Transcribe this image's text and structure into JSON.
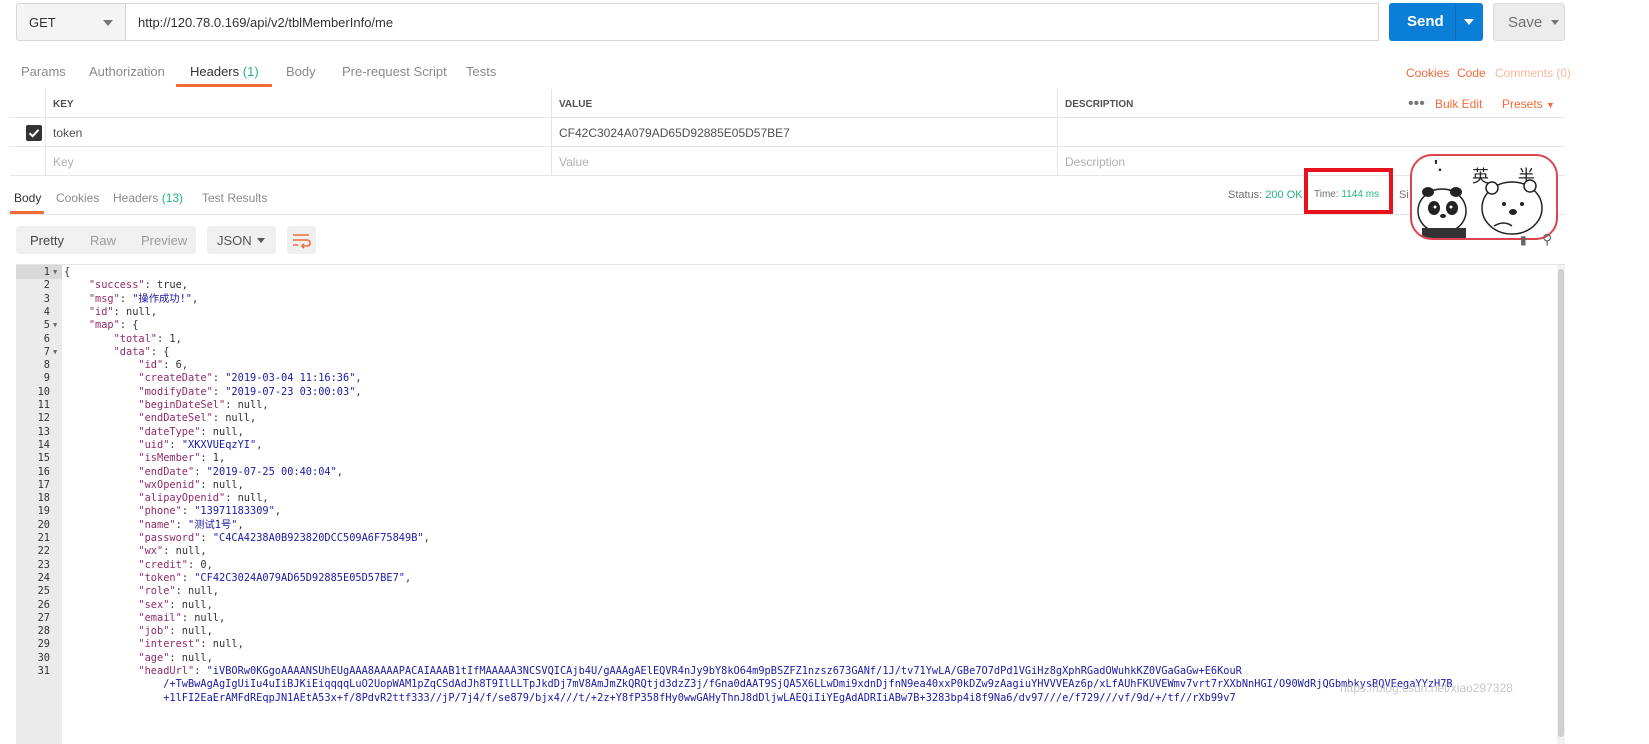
{
  "request": {
    "method": "GET",
    "url": "http://120.78.0.169/api/v2/tblMemberInfo/me",
    "send_label": "Send",
    "save_label": "Save"
  },
  "request_tabs": [
    {
      "label": "Params"
    },
    {
      "label": "Authorization"
    },
    {
      "label": "Headers",
      "count": "(1)"
    },
    {
      "label": "Body"
    },
    {
      "label": "Pre-request Script"
    },
    {
      "label": "Tests"
    }
  ],
  "right_links": {
    "cookies": "Cookies",
    "code": "Code",
    "comments": "Comments (0)"
  },
  "headers_table": {
    "columns": {
      "key": "KEY",
      "value": "VALUE",
      "description": "DESCRIPTION"
    },
    "more": "•••",
    "bulk_edit": "Bulk Edit",
    "presets": "Presets",
    "row": {
      "key": "token",
      "value": "CF42C3024A079AD65D92885E05D57BE7"
    },
    "placeholders": {
      "key": "Key",
      "value": "Value",
      "description": "Description"
    }
  },
  "response_tabs": [
    {
      "label": "Body"
    },
    {
      "label": "Cookies"
    },
    {
      "label": "Headers",
      "count": "(13)"
    },
    {
      "label": "Test Results"
    }
  ],
  "response_meta": {
    "status_label": "Status:",
    "status_value": "200 OK",
    "time_label": "Time:",
    "time_value": "1144 ms",
    "size_label": "Si"
  },
  "sticker": {
    "text": "英 半",
    "mark": "'."
  },
  "view_modes": {
    "pretty": "Pretty",
    "raw": "Raw",
    "preview": "Preview",
    "format": "JSON"
  },
  "code_lines": [
    {
      "n": "1",
      "fold": true,
      "t": "{"
    },
    {
      "n": "2",
      "t": "    \"success\": true,"
    },
    {
      "n": "3",
      "t": "    \"msg\": \"操作成功!\","
    },
    {
      "n": "4",
      "t": "    \"id\": null,"
    },
    {
      "n": "5",
      "fold": true,
      "t": "    \"map\": {"
    },
    {
      "n": "6",
      "t": "        \"total\": 1,"
    },
    {
      "n": "7",
      "fold": true,
      "t": "        \"data\": {"
    },
    {
      "n": "8",
      "t": "            \"id\": 6,"
    },
    {
      "n": "9",
      "t": "            \"createDate\": \"2019-03-04 11:16:36\","
    },
    {
      "n": "10",
      "t": "            \"modifyDate\": \"2019-07-23 03:00:03\","
    },
    {
      "n": "11",
      "t": "            \"beginDateSel\": null,"
    },
    {
      "n": "12",
      "t": "            \"endDateSel\": null,"
    },
    {
      "n": "13",
      "t": "            \"dateType\": null,"
    },
    {
      "n": "14",
      "t": "            \"uid\": \"XKXVUEqzYI\","
    },
    {
      "n": "15",
      "t": "            \"isMember\": 1,"
    },
    {
      "n": "16",
      "t": "            \"endDate\": \"2019-07-25 00:40:04\","
    },
    {
      "n": "17",
      "t": "            \"wxOpenid\": null,"
    },
    {
      "n": "18",
      "t": "            \"alipayOpenid\": null,"
    },
    {
      "n": "19",
      "t": "            \"phone\": \"13971183309\","
    },
    {
      "n": "20",
      "t": "            \"name\": \"测试1号\","
    },
    {
      "n": "21",
      "t": "            \"password\": \"C4CA4238A0B923820DCC509A6F75849B\","
    },
    {
      "n": "22",
      "t": "            \"wx\": null,"
    },
    {
      "n": "23",
      "t": "            \"credit\": 0,"
    },
    {
      "n": "24",
      "t": "            \"token\": \"CF42C3024A079AD65D92885E05D57BE7\","
    },
    {
      "n": "25",
      "t": "            \"role\": null,"
    },
    {
      "n": "26",
      "t": "            \"sex\": null,"
    },
    {
      "n": "27",
      "t": "            \"email\": null,"
    },
    {
      "n": "28",
      "t": "            \"job\": null,"
    },
    {
      "n": "29",
      "t": "            \"interest\": null,"
    },
    {
      "n": "30",
      "t": "            \"age\": null,"
    },
    {
      "n": "31",
      "t": "            \"headUrl\": \"iVBORw0KGgoAAAANSUhEUgAAA8AAAAPACAIAAAB1tIfMAAAAA3NCSVQICAjb4U/gAAAgAElEQVR4nJy9bY8kO64m9pBSZFZ1nzsz673GANf/1J/tv71YwLA/GBe7O7dPd1VGiHz8gXphRGadOWuhkKZ0VGaGaGw+E6KouR"
    },
    {
      "n": "",
      "t": "                /+TwBwAgAgIgUiIu4uIiBJKiEiqqqqLuO2UopWAM1pZqCSdAdJh8T9IlLLTpJkdDj7mV8AmJmZkQRQtjd3dzZ3j/fGna0dAAT9SjQA5X6LLwDmi9xdnDjfnN9ea40xxP0kDZw9zAagiuYHVVVEAz6p/xLfAUhFKUVEWmv7vrt7rXXbNnHGI/O90WdRjQGbmbkysBQVEegaYYzH7B"
    },
    {
      "n": "",
      "t": "                +1lFI2EaErAMFdREqpJN1AEtA53x+f/8PdvR2ttf333//jP/7j4/f/se879/bjx4///t/+2z+Y8fP358fHy0wwGAHyThnJ8dDljwLAEQiIiYEgAdADRIiABw7B+3283bp4i8f9Na6/dv97///e/f729///vf/9d/+/tf//rXb99v7"
    }
  ],
  "watermark": "https://blog.csdn.net/xiao297328"
}
